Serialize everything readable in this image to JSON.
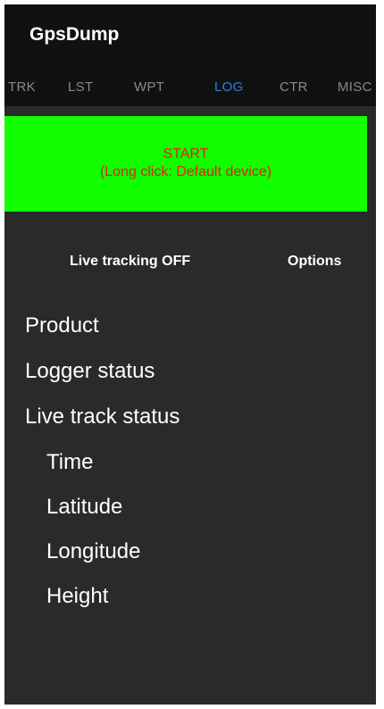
{
  "app": {
    "title": "GpsDump"
  },
  "tabs": [
    {
      "label": "TRK",
      "active": false
    },
    {
      "label": "LST",
      "active": false
    },
    {
      "label": "WPT",
      "active": false
    },
    {
      "label": "LOG",
      "active": true
    },
    {
      "label": "CTR",
      "active": false
    },
    {
      "label": "MISC",
      "active": false
    }
  ],
  "start_button": {
    "line1": "START",
    "line2": "(Long click: Default device)"
  },
  "actions": {
    "live_tracking": "Live tracking OFF",
    "options": "Options"
  },
  "info_items": [
    "Product",
    "Logger status",
    "Live track status",
    "Time",
    "Latitude",
    "Longitude",
    "Height"
  ],
  "colors": {
    "accent_tab": "#2f7fe0",
    "start_bg": "#11ff00",
    "start_text": "#e0201a",
    "background": "#2a2a2a",
    "appbar": "#111111"
  }
}
